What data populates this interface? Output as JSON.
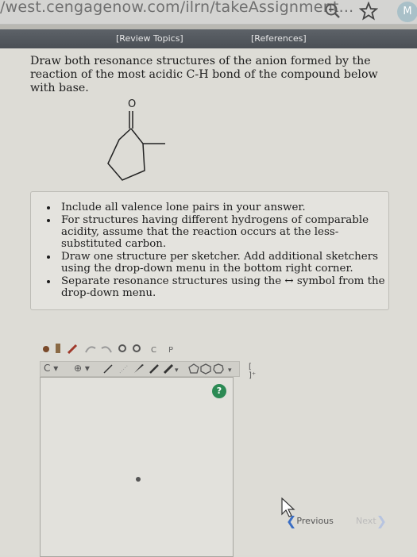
{
  "browser": {
    "url": "/west.cengagenow.com/ilrn/takeAssignment...",
    "avatar_letter": "M"
  },
  "header": {
    "review_topics": "[Review Topics]",
    "references": "[References]"
  },
  "question": {
    "text": "Draw both resonance structures of the anion formed by the reaction of the most acidic C-H bond of the compound below with base.",
    "atom_label": "O"
  },
  "instructions": [
    "Include all valence lone pairs in your answer.",
    "For structures having different hydrogens of comparable acidity, assume that the reaction occurs at the less-substituted carbon.",
    "Draw one structure per sketcher. Add additional sketchers using the drop-down menu in the bottom right corner.",
    "Separate resonance structures using the ↔ symbol from the drop-down menu."
  ],
  "toolbar": {
    "element_label": "C",
    "bracket_label": "[ ]⁺"
  },
  "canvas": {
    "help_label": "?"
  },
  "navigation": {
    "previous": "Previous",
    "next": "Next"
  }
}
